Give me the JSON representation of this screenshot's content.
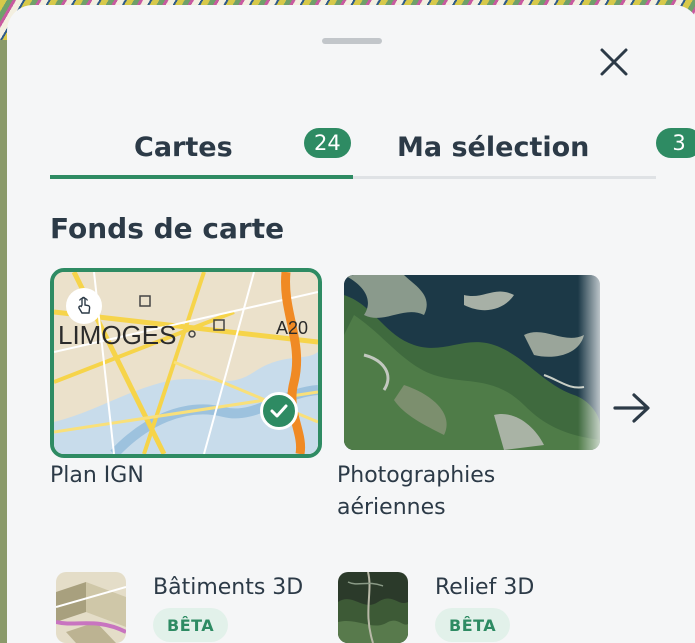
{
  "tabs": [
    {
      "label": "Cartes",
      "count": "24"
    },
    {
      "label": "Ma sélection",
      "count": "3"
    }
  ],
  "active_tab": 0,
  "section": {
    "title": "Fonds de carte"
  },
  "basemaps": [
    {
      "label": "Plan IGN",
      "thumb_text_city": "LIMOGES",
      "thumb_text_road": "A20",
      "selected": true
    },
    {
      "label": "Photographies aériennes",
      "selected": false
    }
  ],
  "layers3d": [
    {
      "title": "Bâtiments 3D",
      "badge": "BÊTA"
    },
    {
      "title": "Relief 3D",
      "badge": "BÊTA"
    }
  ],
  "colors": {
    "accent": "#2e8b63",
    "text": "#2c3a47",
    "sheet": "#f5f6f7"
  }
}
